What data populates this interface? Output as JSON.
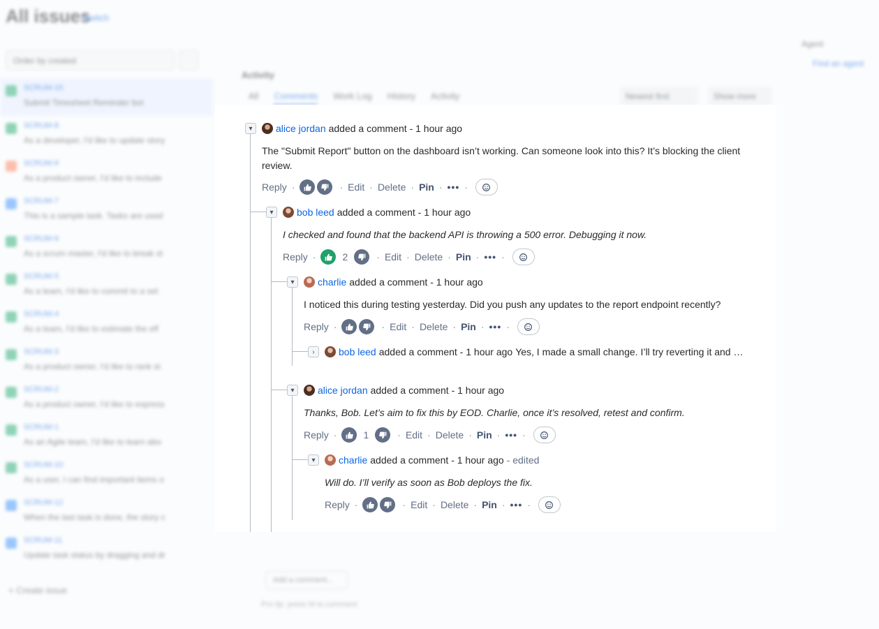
{
  "background": {
    "title": "All issues",
    "switch_label": "Switch",
    "sort_label": "Order by created",
    "issues": [
      {
        "key": "SCRUM-15",
        "text": "Submit Timesheet Reminder bot",
        "color": "#36b37e"
      },
      {
        "key": "SCRUM-8",
        "text": "As a developer, I'd like to update story",
        "color": "#36b37e"
      },
      {
        "key": "SCRUM-9",
        "text": "As a product owner, I'd like to include",
        "color": "#ff8b6a"
      },
      {
        "key": "SCRUM-7",
        "text": "This is a sample task. Tasks are used",
        "color": "#4c9aff"
      },
      {
        "key": "SCRUM-6",
        "text": "As a scrum master, I'd like to break st",
        "color": "#36b37e"
      },
      {
        "key": "SCRUM-5",
        "text": "As a team, I'd like to commit to a set",
        "color": "#36b37e"
      },
      {
        "key": "SCRUM-4",
        "text": "As a team, I'd like to estimate the eff",
        "color": "#36b37e"
      },
      {
        "key": "SCRUM-3",
        "text": "As a product owner, I'd like to rank st",
        "color": "#36b37e"
      },
      {
        "key": "SCRUM-2",
        "text": "As a product owner, I'd like to express",
        "color": "#36b37e"
      },
      {
        "key": "SCRUM-1",
        "text": "As an Agile team, I'd like to learn abo",
        "color": "#36b37e"
      },
      {
        "key": "SCRUM-10",
        "text": "As a user, I can find important items o",
        "color": "#36b37e"
      },
      {
        "key": "SCRUM-12",
        "text": "When the last task is done, the story c",
        "color": "#4c9aff"
      },
      {
        "key": "SCRUM-11",
        "text": "Update task status by dragging and dr",
        "color": "#4c9aff"
      }
    ],
    "create_label": "+ Create issue",
    "activity_label": "Activity",
    "tabs": [
      "All",
      "Comments",
      "Work Log",
      "History",
      "Activity"
    ],
    "newest_label": "Newest first",
    "news_label": "Show more",
    "right_label": "Agent",
    "right_link": "Find an agent",
    "add_comment": "Add a comment...",
    "pro_tip": "Pro tip: press M to comment"
  },
  "comments": [
    {
      "id": "c1",
      "author": "alice jordan",
      "meta": "added a comment - 1 hour ago",
      "body": "The \"Submit Report\" button on the dashboard isn’t working. Can someone look into this? It’s blocking the client review.",
      "italic": false,
      "likes": ""
    },
    {
      "id": "c2",
      "author": "bob leed",
      "meta": "added a comment - 1 hour ago",
      "body": "I checked and found that the backend API is throwing a 500 error. Debugging it now.",
      "italic": true,
      "likes": "2"
    },
    {
      "id": "c3",
      "author": "charlie",
      "meta": "added a comment - 1 hour ago",
      "body": "I noticed this during testing yesterday. Did you push any updates to the report endpoint recently?",
      "italic": false,
      "likes": ""
    },
    {
      "id": "c4",
      "author": "bob leed",
      "meta": "added a comment - 1 hour ago",
      "preview": "Yes, I made a small change. I’ll try reverting it and …"
    },
    {
      "id": "c5",
      "author": "alice jordan",
      "meta": "added a comment - 1 hour ago",
      "body": "Thanks, Bob. Let’s aim to fix this by EOD. Charlie, once it’s resolved, retest and confirm.",
      "italic": true,
      "likes": "1"
    },
    {
      "id": "c6",
      "author": "charlie",
      "meta": "added a comment - 1 hour ago",
      "edited": "- edited",
      "body": "Will do. I’ll verify as soon as Bob deploys the fix.",
      "italic": true,
      "likes": ""
    }
  ],
  "actions": {
    "reply": "Reply",
    "edit": "Edit",
    "delete": "Delete",
    "pin": "Pin",
    "more": "•••",
    "sep": "·"
  },
  "colors": {
    "link": "#0c66e4",
    "liked": "#22a06b",
    "thumb": "#626f86"
  }
}
